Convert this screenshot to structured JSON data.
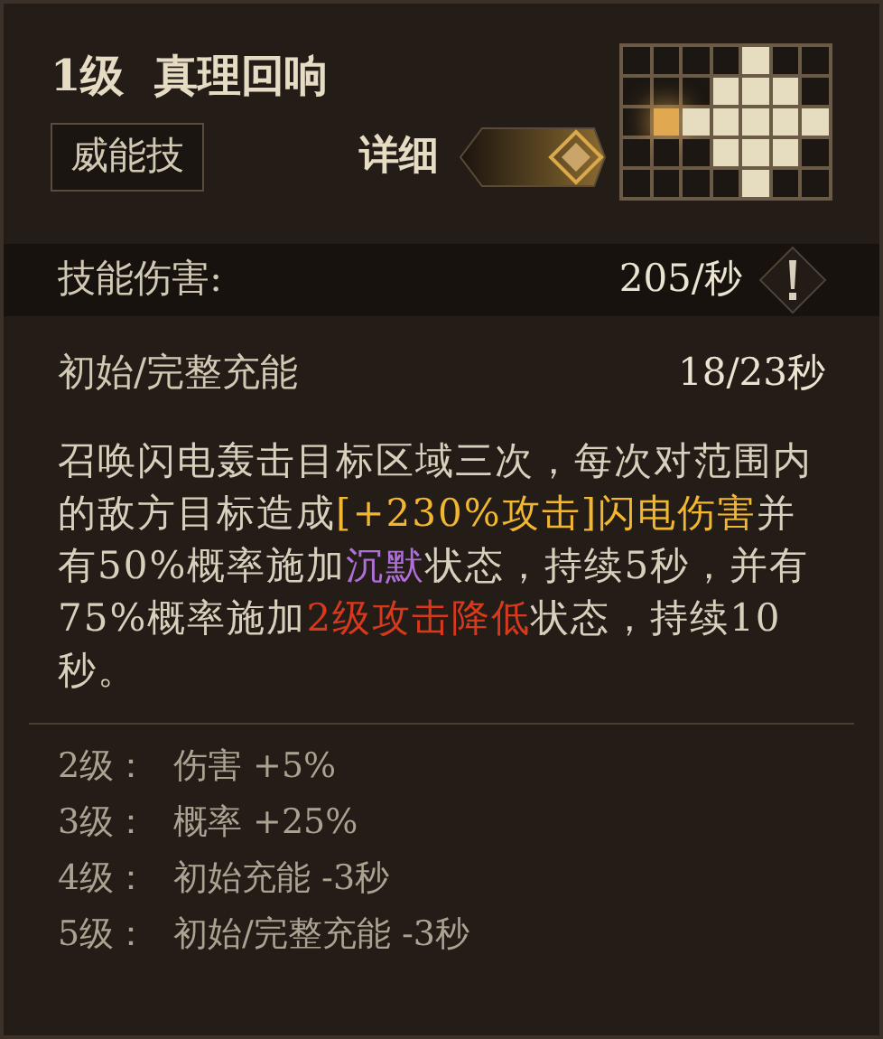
{
  "header": {
    "title": "1级  真理回响",
    "tag": "威能技",
    "detail_label": "详细",
    "detail_toggle": {
      "on": true
    }
  },
  "pattern": {
    "rows": [
      [
        {
          "kind": "empty"
        },
        {
          "kind": "empty"
        },
        {
          "kind": "empty"
        },
        {
          "kind": "empty"
        },
        {
          "kind": "filled"
        },
        {
          "kind": "empty"
        },
        {
          "kind": "empty"
        }
      ],
      [
        {
          "kind": "empty"
        },
        {
          "kind": "empty"
        },
        {
          "kind": "empty"
        },
        {
          "kind": "filled"
        },
        {
          "kind": "filled"
        },
        {
          "kind": "filled"
        },
        {
          "kind": "empty"
        }
      ],
      [
        {
          "kind": "empty"
        },
        {
          "kind": "origin"
        },
        {
          "kind": "filled"
        },
        {
          "kind": "filled"
        },
        {
          "kind": "filled"
        },
        {
          "kind": "filled"
        },
        {
          "kind": "filled"
        }
      ],
      [
        {
          "kind": "empty"
        },
        {
          "kind": "empty"
        },
        {
          "kind": "empty"
        },
        {
          "kind": "filled"
        },
        {
          "kind": "filled"
        },
        {
          "kind": "filled"
        },
        {
          "kind": "empty"
        }
      ],
      [
        {
          "kind": "empty"
        },
        {
          "kind": "empty"
        },
        {
          "kind": "empty"
        },
        {
          "kind": "empty"
        },
        {
          "kind": "filled"
        },
        {
          "kind": "empty"
        },
        {
          "kind": "empty"
        }
      ]
    ]
  },
  "stats": [
    {
      "label": "技能伤害:",
      "value": "205/秒",
      "info": true
    },
    {
      "label": "初始/完整充能",
      "value": "18/23秒"
    }
  ],
  "description": [
    {
      "text": "召唤闪电轰击目标区域三次，每次对范围内的敌方目标造成",
      "color": "#d8d0bc"
    },
    {
      "text": "[+230%攻击]闪电伤害",
      "color": "#f2b630"
    },
    {
      "text": "并有50%概率施加",
      "color": "#d8d0bc"
    },
    {
      "text": "沉默",
      "color": "#b06fd8"
    },
    {
      "text": "状态，持续5秒，并有75%概率施加",
      "color": "#d8d0bc"
    },
    {
      "text": "2级攻击降低",
      "color": "#d8391c"
    },
    {
      "text": "状态，持续10秒。",
      "color": "#d8d0bc"
    }
  ],
  "upgrades": [
    {
      "level": "2级：",
      "effect": "伤害 +5%"
    },
    {
      "level": "3级：",
      "effect": "概率 +25%"
    },
    {
      "level": "4级：",
      "effect": "初始充能 -3秒"
    },
    {
      "level": "5级：",
      "effect": "初始/完整充能 -3秒"
    }
  ]
}
